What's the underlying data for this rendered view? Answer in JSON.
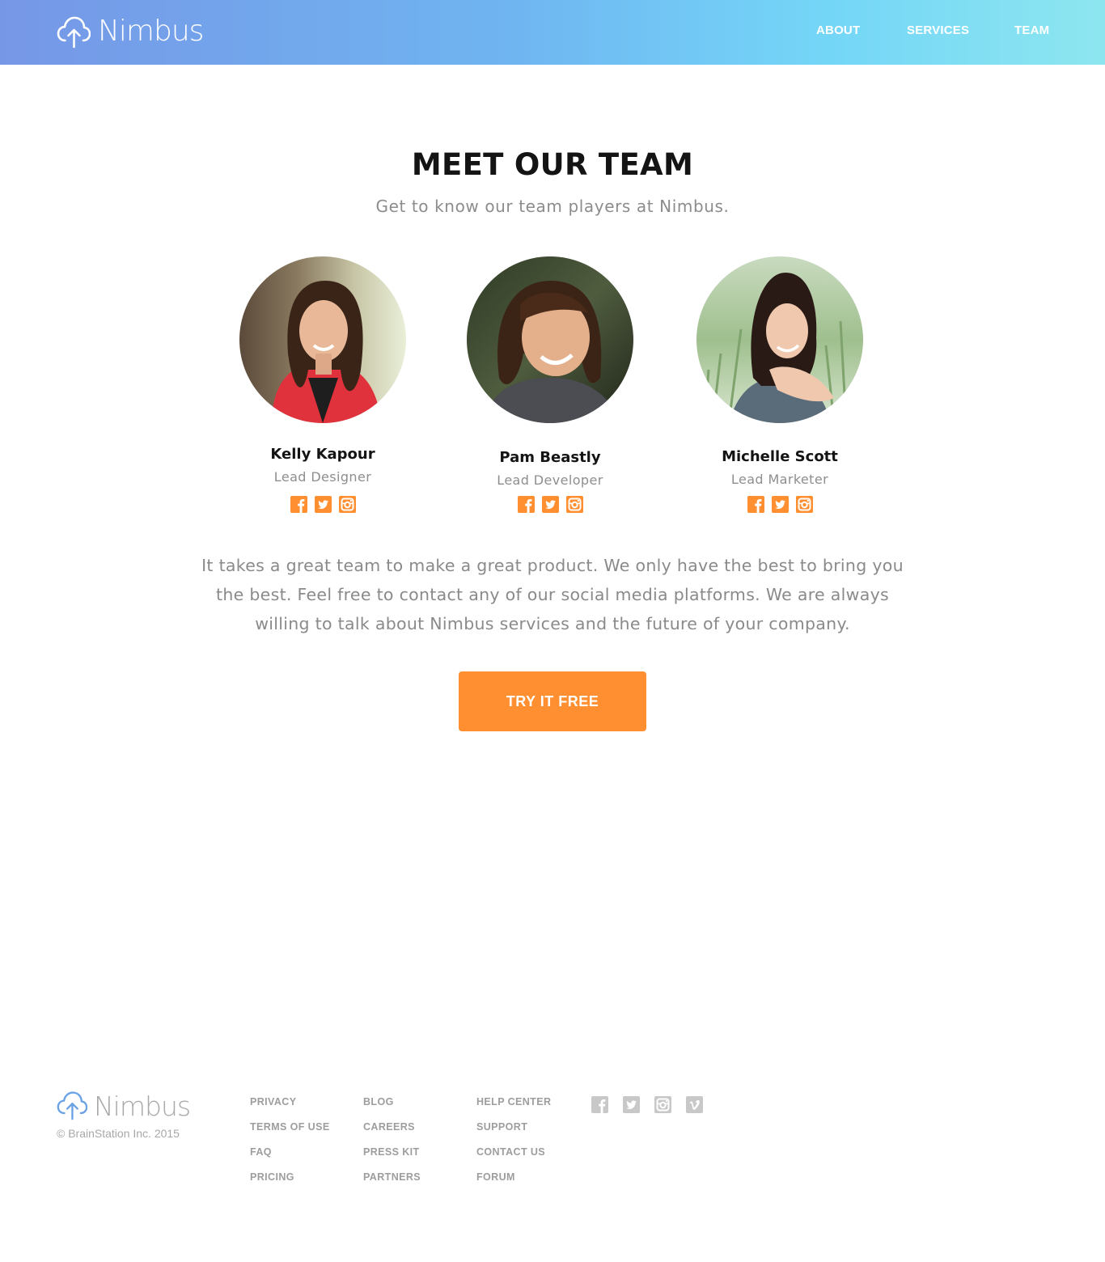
{
  "header": {
    "brand": "Nimbus",
    "nav": [
      {
        "label": "ABOUT"
      },
      {
        "label": "SERVICES"
      },
      {
        "label": "TEAM"
      }
    ]
  },
  "team": {
    "title": "MEET OUR TEAM",
    "subtitle": "Get to know our team players at Nimbus.",
    "members": [
      {
        "name": "Kelly Kapour",
        "role": "Lead Designer"
      },
      {
        "name": "Pam Beastly",
        "role": "Lead Developer"
      },
      {
        "name": "Michelle Scott",
        "role": "Lead Marketer"
      }
    ],
    "member_social_icons": [
      "facebook-icon",
      "twitter-icon",
      "instagram-icon"
    ],
    "description": "It takes a great team to make a great product. We only have the best to bring you the best. Feel free to contact any of our social media platforms. We are always willing to talk about Nimbus services and the future of your company.",
    "cta_label": "TRY IT FREE"
  },
  "footer": {
    "brand": "Nimbus",
    "copyright": "© BrainStation Inc. 2015",
    "columns": [
      [
        "PRIVACY",
        "TERMS OF USE",
        "FAQ",
        "PRICING"
      ],
      [
        "BLOG",
        "CAREERS",
        "PRESS KIT",
        "PARTNERS"
      ],
      [
        "HELP CENTER",
        "SUPPORT",
        "CONTACT US",
        "FORUM"
      ]
    ],
    "social_icons": [
      "facebook-icon",
      "twitter-icon",
      "instagram-icon",
      "vimeo-icon"
    ]
  },
  "colors": {
    "accent": "#ff8f30",
    "header_gradient_start": "#7697e6",
    "header_gradient_end": "#8de6ef",
    "footer_text": "#9d9d9d"
  }
}
